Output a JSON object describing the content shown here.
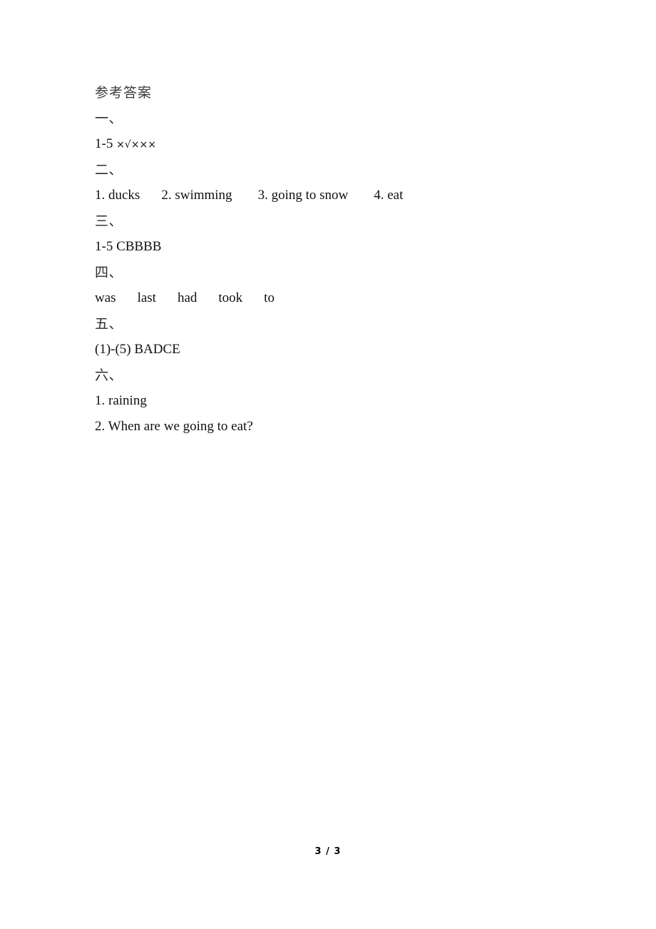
{
  "document": {
    "title": "参考答案",
    "page_footer": "3 / 3",
    "page_current": "3",
    "page_total": "3"
  },
  "sections": [
    {
      "heading": "一、",
      "answer": "1-5 ×√×××",
      "answer_prefix": "1-5 ",
      "answer_marks": "×√×××"
    },
    {
      "heading": "二、",
      "answer": "1. ducks    2. swimming      3. going to snow      4. eat",
      "items": [
        "1. ducks",
        "2. swimming",
        "3. going to snow",
        "4. eat"
      ]
    },
    {
      "heading": "三、",
      "answer": "1-5 CBBBB"
    },
    {
      "heading": "四、",
      "answer": "was    last    had    took    to",
      "items": [
        "was",
        "last",
        "had",
        "took",
        "to"
      ]
    },
    {
      "heading": "五、",
      "answer": "(1)-(5) BADCE"
    },
    {
      "heading": "六、",
      "answer_lines": [
        "1. raining",
        "2. When are we going to eat?"
      ]
    }
  ]
}
